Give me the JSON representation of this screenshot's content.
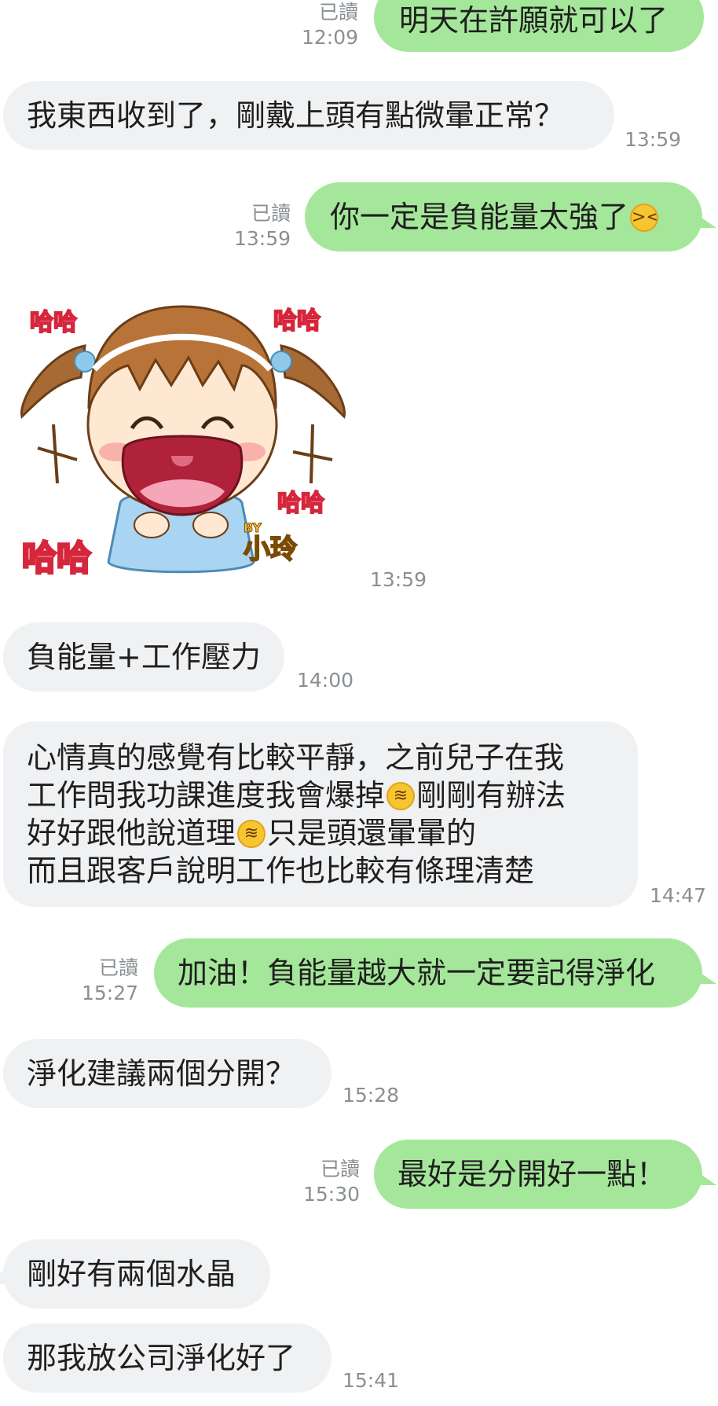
{
  "messages": [
    {
      "id": "m1",
      "direction": "out",
      "text": "明天在許願就可以了",
      "read": "已讀",
      "time": "12:09"
    },
    {
      "id": "m2",
      "direction": "in",
      "text": "我東西收到了，剛戴上頭有點微暈正常？",
      "time": "13:59"
    },
    {
      "id": "m3",
      "direction": "out",
      "text": "你一定是負能量太強了",
      "emoji": "laughing-squint-emoji",
      "read": "已讀",
      "time": "13:59"
    },
    {
      "id": "m4",
      "direction": "in",
      "type": "sticker",
      "time": "13:59",
      "sticker": {
        "texts": [
          "哈哈",
          "哈哈",
          "哈哈",
          "哈哈"
        ],
        "byline_small": "BY",
        "byline": "小玲"
      }
    },
    {
      "id": "m5",
      "direction": "in",
      "text": "負能量+工作壓力",
      "time": "14:00"
    },
    {
      "id": "m6",
      "direction": "in",
      "time": "14:47",
      "lines": [
        {
          "before": "心情真的感覺有比較平靜，之前兒子在我"
        },
        {
          "before": "工作問我功課進度我會爆掉",
          "emoji": "rolling-on-floor-laughing-emoji",
          "after": "剛剛有辦法"
        },
        {
          "before": "好好跟他說道理",
          "emoji": "rolling-on-floor-laughing-emoji",
          "after": "只是頭還暈暈的"
        },
        {
          "before": "而且跟客戶說明工作也比較有條理清楚"
        }
      ]
    },
    {
      "id": "m7",
      "direction": "out",
      "text": "加油！負能量越大就一定要記得淨化",
      "read": "已讀",
      "time": "15:27"
    },
    {
      "id": "m8",
      "direction": "in",
      "text": "淨化建議兩個分開？",
      "time": "15:28"
    },
    {
      "id": "m9",
      "direction": "out",
      "text": "最好是分開好一點！",
      "read": "已讀",
      "time": "15:30"
    },
    {
      "id": "m10",
      "direction": "in",
      "text": "剛好有兩個水晶"
    },
    {
      "id": "m11",
      "direction": "in",
      "text": "那我放公司淨化好了",
      "time": "15:41"
    }
  ],
  "colors": {
    "outgoing_bubble": "#a5e79a",
    "incoming_bubble": "#f0f1f3",
    "meta_text": "#8a8f93",
    "emoji_face": "#f7c531"
  }
}
